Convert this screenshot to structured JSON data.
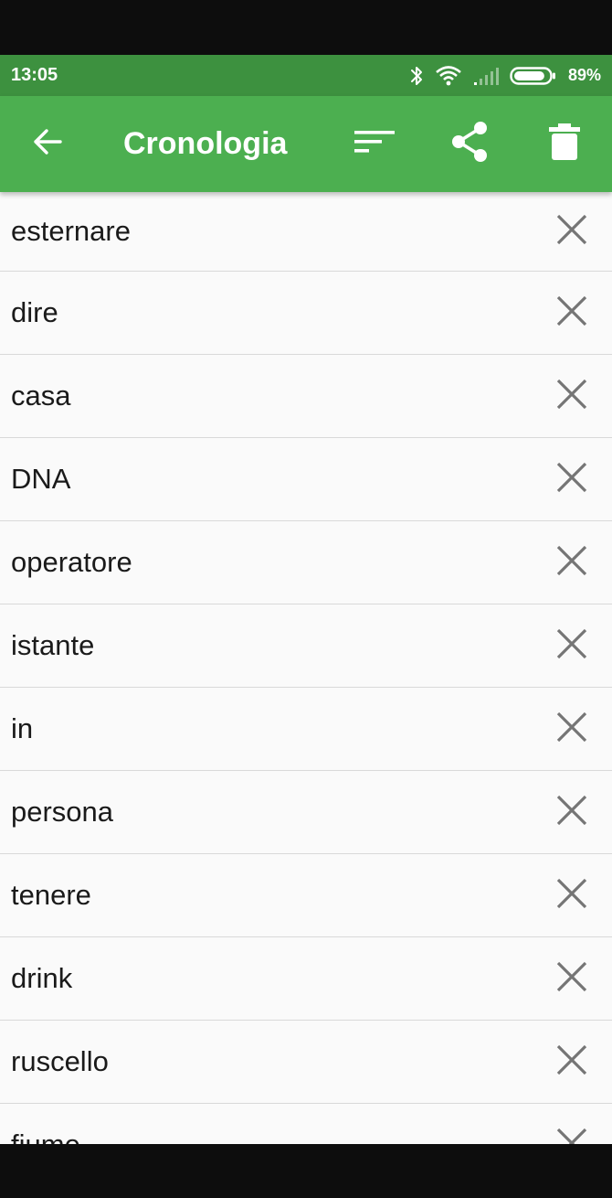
{
  "status_bar": {
    "time": "13:05",
    "battery_percent": "89%",
    "battery_level": 0.89,
    "icons": [
      "bluetooth-icon",
      "wifi-icon",
      "signal-icon",
      "battery-icon"
    ]
  },
  "app_bar": {
    "title": "Cronologia",
    "background": "#4caf50",
    "status_background": "#3d913f",
    "icons": [
      "back-arrow-icon",
      "sort-icon",
      "share-icon",
      "trash-icon"
    ]
  },
  "history": {
    "items": [
      {
        "label": "esternare"
      },
      {
        "label": "dire"
      },
      {
        "label": "casa"
      },
      {
        "label": "DNA"
      },
      {
        "label": "operatore"
      },
      {
        "label": "istante"
      },
      {
        "label": "in"
      },
      {
        "label": "persona"
      },
      {
        "label": "tenere"
      },
      {
        "label": "drink"
      },
      {
        "label": "ruscello"
      },
      {
        "label": "fiume"
      }
    ],
    "remove_icon": "close-icon"
  }
}
